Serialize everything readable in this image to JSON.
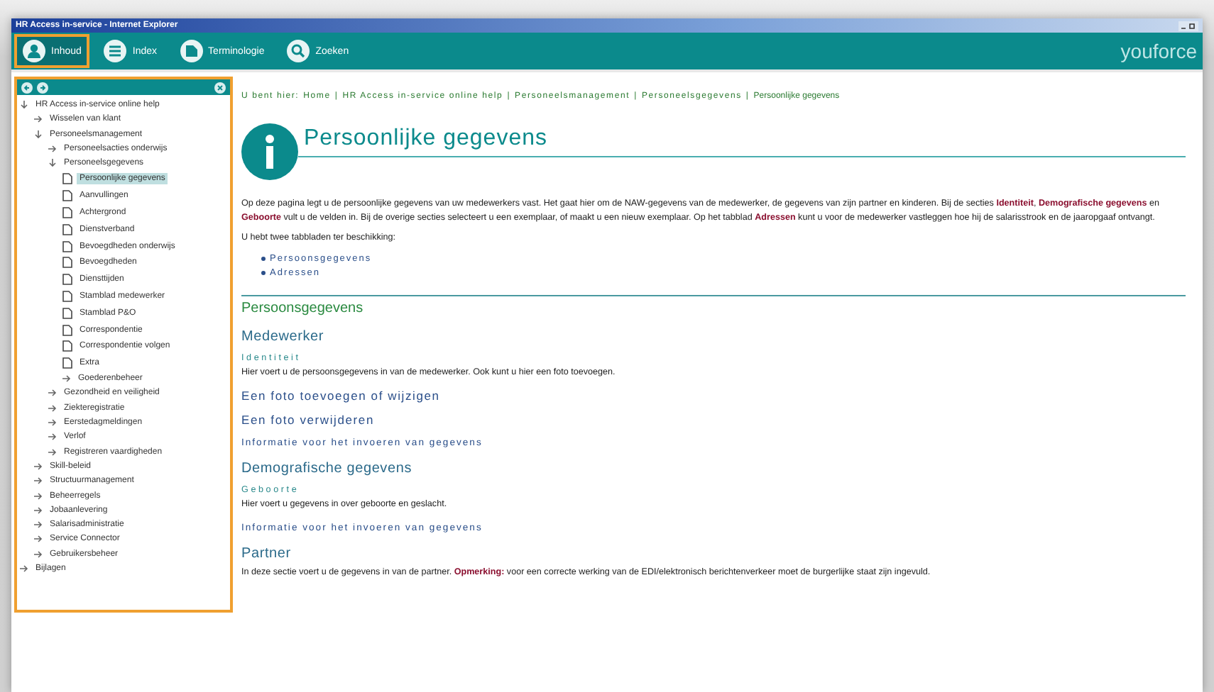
{
  "window": {
    "title": "HR Access in-service - Internet Explorer"
  },
  "toolbar": {
    "buttons": [
      {
        "label": "Inhoud",
        "selected": true
      },
      {
        "label": "Index",
        "selected": false
      },
      {
        "label": "Terminologie",
        "selected": false
      },
      {
        "label": "Zoeken",
        "selected": false
      }
    ],
    "logo": "youforce"
  },
  "tree": [
    {
      "kind": "folder",
      "label": "HR Access in-service online help",
      "expanded": true,
      "selected": false,
      "children": [
        {
          "kind": "folder",
          "label": "Wisselen van klant",
          "expanded": false,
          "selected": false
        },
        {
          "kind": "folder",
          "label": "Personeelsmanagement",
          "expanded": true,
          "selected": false,
          "children": [
            {
              "kind": "folder",
              "label": "Personeelsacties onderwijs",
              "expanded": false,
              "selected": false
            },
            {
              "kind": "folder",
              "label": "Personeelsgegevens",
              "expanded": true,
              "selected": false,
              "children": [
                {
                  "kind": "page",
                  "label": "Persoonlijke gegevens",
                  "selected": true
                },
                {
                  "kind": "page",
                  "label": "Aanvullingen",
                  "selected": false
                },
                {
                  "kind": "page",
                  "label": "Achtergrond",
                  "selected": false
                },
                {
                  "kind": "page",
                  "label": "Dienstverband",
                  "selected": false
                },
                {
                  "kind": "page",
                  "label": "Bevoegdheden onderwijs",
                  "selected": false
                },
                {
                  "kind": "page",
                  "label": "Bevoegdheden",
                  "selected": false
                },
                {
                  "kind": "page",
                  "label": "Diensttijden",
                  "selected": false
                },
                {
                  "kind": "page",
                  "label": "Stamblad medewerker",
                  "selected": false
                },
                {
                  "kind": "page",
                  "label": "Stamblad P&O",
                  "selected": false
                },
                {
                  "kind": "page",
                  "label": "Correspondentie",
                  "selected": false
                },
                {
                  "kind": "page",
                  "label": "Correspondentie volgen",
                  "selected": false
                },
                {
                  "kind": "page",
                  "label": "Extra",
                  "selected": false
                },
                {
                  "kind": "folder",
                  "label": "Goederenbeheer",
                  "expanded": false,
                  "selected": false
                }
              ]
            },
            {
              "kind": "folder",
              "label": "Gezondheid en veiligheid",
              "expanded": false,
              "selected": false
            },
            {
              "kind": "folder",
              "label": "Ziekteregistratie",
              "expanded": false,
              "selected": false
            },
            {
              "kind": "folder",
              "label": "Eerstedagmeldingen",
              "expanded": false,
              "selected": false
            },
            {
              "kind": "folder",
              "label": "Verlof",
              "expanded": false,
              "selected": false
            },
            {
              "kind": "folder",
              "label": "Registreren vaardigheden",
              "expanded": false,
              "selected": false
            }
          ]
        },
        {
          "kind": "folder",
          "label": "Skill-beleid",
          "expanded": false,
          "selected": false
        },
        {
          "kind": "folder",
          "label": "Structuurmanagement",
          "expanded": false,
          "selected": false
        },
        {
          "kind": "folder",
          "label": "Beheerregels",
          "expanded": false,
          "selected": false
        },
        {
          "kind": "folder",
          "label": "Jobaanlevering",
          "expanded": false,
          "selected": false
        },
        {
          "kind": "folder",
          "label": "Salarisadministratie",
          "expanded": false,
          "selected": false
        },
        {
          "kind": "folder",
          "label": "Service Connector",
          "expanded": false,
          "selected": false
        },
        {
          "kind": "folder",
          "label": "Gebruikersbeheer",
          "expanded": false,
          "selected": false
        }
      ]
    },
    {
      "kind": "folder",
      "label": "Bijlagen",
      "expanded": false,
      "selected": false
    }
  ],
  "breadcrumb": {
    "prefix": "U bent hier:",
    "separator": "|",
    "items": [
      "Home",
      "HR Access in-service online help",
      "Personeelsmanagement",
      "Personeelsgegevens",
      "Persoonlijke gegevens"
    ]
  },
  "page_title": "Persoonlijke gegevens",
  "intro": "Op deze pagina legt u de persoonlijke gegevens van uw medewerkers vast. Het gaat hier om de NAW-gegevens van de medewerker, de gegevens van zijn partner en kinderen. Bij de secties **Identiteit**, **Demografische gegevens** en **Geboorte** vult u de velden in. Bij de overige secties selecteert u een exemplaar, of maakt u een nieuw exemplaar. Op het tabblad **Adressen** kunt u voor de medewerker vastleggen hoe hij de salarisstrook en de jaaropgaaf ontvangt.",
  "tabs_intro": "U hebt twee tabbladen ter beschikking:",
  "tab_links": [
    "Persoonsgegevens",
    "Adressen"
  ],
  "sections": [
    {
      "kind": "h2",
      "text": "Persoonsgegevens"
    },
    {
      "kind": "h3",
      "text": "Medewerker"
    },
    {
      "kind": "label",
      "text": "Identiteit"
    },
    {
      "kind": "para",
      "text": "Hier voert u de persoonsgegevens in van de medewerker. Ook kunt u hier een foto toevoegen."
    },
    {
      "kind": "h4",
      "text": "Een foto toevoegen of wijzigen"
    },
    {
      "kind": "h4",
      "text": "Een foto verwijderen"
    },
    {
      "kind": "info",
      "text": "Informatie voor het invoeren van gegevens"
    },
    {
      "kind": "h3",
      "text": "Demografische gegevens"
    },
    {
      "kind": "label",
      "text": "Geboorte"
    },
    {
      "kind": "para",
      "text": "Hier voert u gegevens in over geboorte en geslacht."
    },
    {
      "kind": "info",
      "text": "Informatie voor het invoeren van gegevens"
    },
    {
      "kind": "h3",
      "text": "Partner"
    },
    {
      "kind": "para",
      "text": "In deze sectie voert u de gegevens in van de partner. **Opmerking:** voor een correcte werking van de EDI/elektronisch berichtenverkeer moet de burgerlijke staat zijn ingevuld."
    }
  ]
}
